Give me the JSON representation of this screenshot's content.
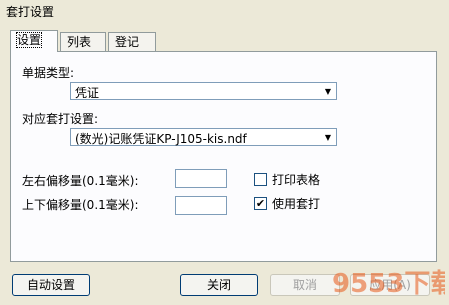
{
  "window": {
    "title": "套打设置"
  },
  "tabs": [
    {
      "label": "设置",
      "active": true
    },
    {
      "label": "列表",
      "active": false
    },
    {
      "label": "登记",
      "active": false
    }
  ],
  "form": {
    "doc_type_label": "单据类型:",
    "doc_type_value": "凭证",
    "print_setting_label": "对应套打设置:",
    "print_setting_value": "(数光)记账凭证KP-J105-kis.ndf",
    "lr_offset_label": "左右偏移量(0.1毫米):",
    "lr_offset_value": "",
    "ud_offset_label": "上下偏移量(0.1毫米):",
    "ud_offset_value": "",
    "print_table_label": "打印表格",
    "print_table_checked": false,
    "use_template_label": "使用套打",
    "use_template_checked": true
  },
  "buttons": {
    "auto_setup": "自动设置",
    "close": "关闭",
    "cancel": "取消",
    "apply": "应用(A)"
  },
  "watermark": {
    "text": "9553下载"
  }
}
